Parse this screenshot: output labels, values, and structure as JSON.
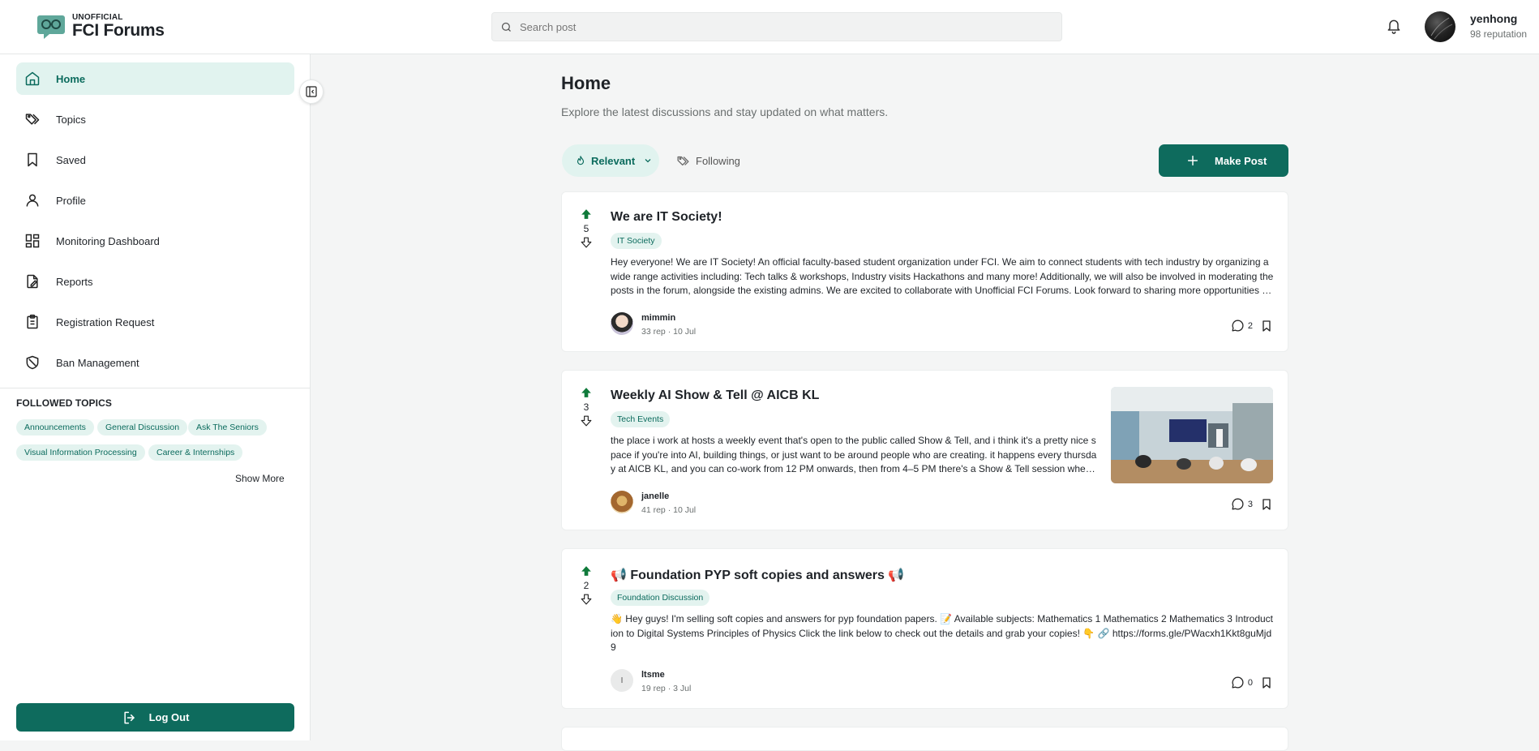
{
  "app": {
    "logo_small": "UNOFFICIAL",
    "logo_big": "FCI Forums"
  },
  "search": {
    "placeholder": "Search post"
  },
  "user": {
    "name": "yenhong",
    "reputation": "98 reputation"
  },
  "sidebar": {
    "items": [
      {
        "label": "Home",
        "icon": "home-icon",
        "active": true
      },
      {
        "label": "Topics",
        "icon": "tags-icon"
      },
      {
        "label": "Saved",
        "icon": "bookmark-icon"
      },
      {
        "label": "Profile",
        "icon": "user-icon"
      },
      {
        "label": "Monitoring Dashboard",
        "icon": "dashboard-icon"
      },
      {
        "label": "Reports",
        "icon": "report-icon"
      },
      {
        "label": "Registration Request",
        "icon": "clipboard-icon"
      },
      {
        "label": "Ban Management",
        "icon": "shield-ban-icon"
      }
    ],
    "followed_title": "FOLLOWED TOPICS",
    "followed_topics": [
      "Announcements",
      "General Discussion",
      "Ask The Seniors",
      "Visual Information Processing",
      "Career & Internships"
    ],
    "show_more": "Show More",
    "logout": "Log Out"
  },
  "main": {
    "title": "Home",
    "subtitle": "Explore the latest discussions and stay updated on what matters.",
    "sort_label": "Relevant",
    "following_label": "Following",
    "make_post_label": "Make Post"
  },
  "posts": [
    {
      "votes": "5",
      "title": "We are IT Society!",
      "tag": "IT Society",
      "body": "Hey everyone! We are IT Society! An official faculty-based student organization under FCI. We aim to connect students with tech industry by organizing a wide range activities including: Tech talks & workshops, Industry visits Hackathons and many more! Additionally, we will also be involved in moderating the posts in the forum, alongside the existing admins. We are excited to collaborate with Unofficial FCI Forums. Look forward to sharing more opportunities with you all!",
      "author": "mimmin",
      "rep": "33 rep",
      "date": "10 Jul",
      "comments": "2"
    },
    {
      "votes": "3",
      "title": "Weekly AI Show & Tell @ AICB KL",
      "tag": "Tech Events",
      "body": "the place i work at hosts a weekly event that's open to the public called Show & Tell, and i think it's a pretty nice space if you're into AI, building things, or just want to be around people who are creating. it happens every thursday at AICB KL, and you can co-work from 12 PM onwards, then from 4–5 PM there's a Show & Tell session where people share what they've been building.",
      "author": "janelle",
      "rep": "41 rep",
      "date": "10 Jul",
      "comments": "3"
    },
    {
      "votes": "2",
      "title": "📢 Foundation PYP soft copies and answers 📢",
      "tag": "Foundation Discussion",
      "body": "👋 Hey guys! I'm selling soft copies and answers for pyp foundation papers. 📝 Available subjects: Mathematics 1 Mathematics 2 Mathematics 3 Introduction to Digital Systems Principles of Physics Click the link below to check out the details and grab your copies! 👇 🔗 https://forms.gle/PWacxh1Kkt8guMjd9",
      "author": "ltsme",
      "author_initial": "I",
      "rep": "19 rep",
      "date": "3 Jul",
      "comments": "0"
    }
  ],
  "colors": {
    "accent": "#0e6b5d",
    "accent_light": "#e1f3ef",
    "upvote": "#0f7a3a"
  }
}
